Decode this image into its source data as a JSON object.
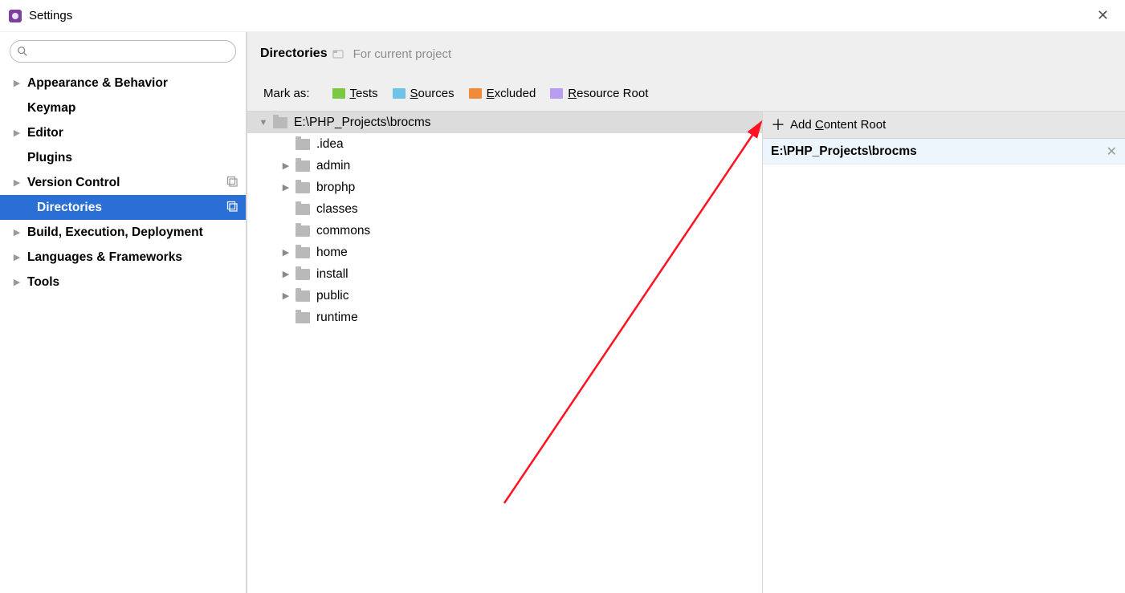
{
  "window": {
    "title": "Settings"
  },
  "sidebar": {
    "items": [
      {
        "label": "Appearance & Behavior",
        "expandable": true,
        "indent": false
      },
      {
        "label": "Keymap",
        "expandable": false,
        "indent": false
      },
      {
        "label": "Editor",
        "expandable": true,
        "indent": false
      },
      {
        "label": "Plugins",
        "expandable": false,
        "indent": false
      },
      {
        "label": "Version Control",
        "expandable": true,
        "indent": false,
        "badge": true
      },
      {
        "label": "Directories",
        "expandable": false,
        "indent": true,
        "selected": true,
        "badge": true
      },
      {
        "label": "Build, Execution, Deployment",
        "expandable": true,
        "indent": false
      },
      {
        "label": "Languages & Frameworks",
        "expandable": true,
        "indent": false
      },
      {
        "label": "Tools",
        "expandable": true,
        "indent": false
      }
    ]
  },
  "header": {
    "title": "Directories",
    "scope": "For current project"
  },
  "mark": {
    "label": "Mark as:",
    "tests": "Tests",
    "sources": "Sources",
    "excluded": "Excluded",
    "resource": "Resource Root"
  },
  "tree": {
    "root": "E:\\PHP_Projects\\brocms",
    "children": [
      {
        "label": ".idea",
        "expandable": false
      },
      {
        "label": "admin",
        "expandable": true
      },
      {
        "label": "brophp",
        "expandable": true
      },
      {
        "label": "classes",
        "expandable": false
      },
      {
        "label": "commons",
        "expandable": false
      },
      {
        "label": "home",
        "expandable": true
      },
      {
        "label": "install",
        "expandable": true
      },
      {
        "label": "public",
        "expandable": true
      },
      {
        "label": "runtime",
        "expandable": false
      }
    ]
  },
  "right": {
    "add_label": "Add Content Root",
    "add_mnemonic_index": 4,
    "roots": [
      {
        "label": "E:\\PHP_Projects\\brocms"
      }
    ]
  },
  "colors": {
    "selection": "#2a6fd6",
    "tests": "#7ac943",
    "sources": "#6fc3e8",
    "excluded": "#f08b3c",
    "resource": "#b89df0"
  }
}
